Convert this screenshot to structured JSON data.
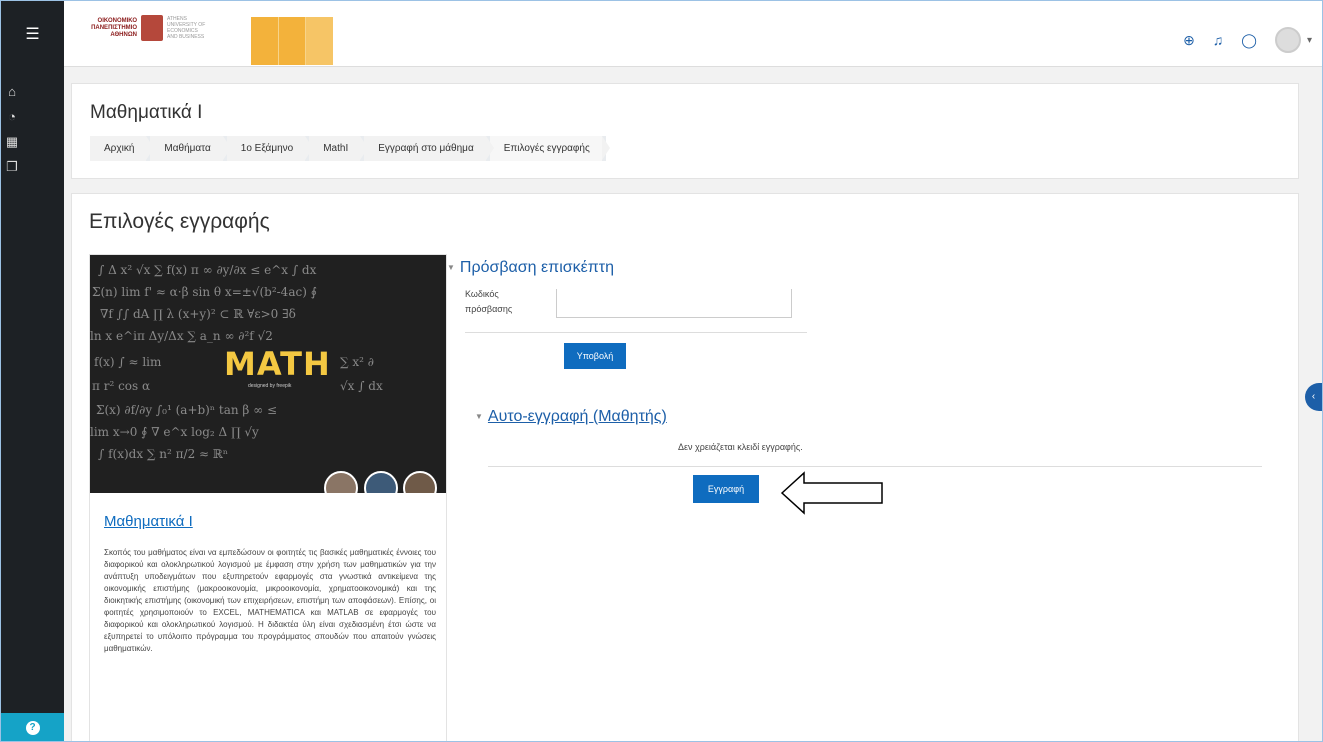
{
  "header": {
    "logo_greek": "ΟΙΚΟΝΟΜΙΚΟ ΠΑΝΕΠΙΣΤΗΜΙΟ ΑΘΗΝΩΝ",
    "logo_english": "ATHENS UNIVERSITY OF ECONOMICS AND BUSINESS"
  },
  "page": {
    "course_title": "Μαθηματικά Ι",
    "breadcrumb": [
      "Αρχική",
      "Μαθήματα",
      "1ο Εξάμηνο",
      "MathI",
      "Εγγραφή στο μάθημα",
      "Επιλογές εγγραφής"
    ],
    "heading": "Επιλογές εγγραφής"
  },
  "course": {
    "image_text": "MATH",
    "image_credit": "designed by freepik",
    "link": "Μαθηματικά Ι",
    "summary": "Σκοπός του μαθήματος είναι να εμπεδώσουν οι φοιτητές τις βασικές μαθηματικές έννοιες του διαφορικού και ολοκληρωτικού λογισμού με έμφαση στην χρήση των μαθηματικών για την ανάπτυξη υποδειγμάτων που εξυπηρετούν εφαρμογές στα γνωστικά αντικείμενα της οικονομικής επιστήμης (μακροοικονομία, μικροοικονομία, χρηματοοικονομικά) και της διοικητικής επιστήμης (οικονομική των επιχειρήσεων, επιστήμη των αποφάσεων). Επίσης, οι φοιτητές χρησιμοποιούν το EXCEL, MATHEMATICA και MATLAB σε εφαρμογές του διαφορικού και ολοκληρωτικού λογισμού. Η διδακτέα ύλη είναι σχεδιασμένη έτσι ώστε να εξυπηρετεί το υπόλοιπο πρόγραμμα του προγράμματος σπουδών που απαιτούν γνώσεις μαθηματικών."
  },
  "guest": {
    "title": "Πρόσβαση επισκέπτη",
    "password_label": "Κωδικός πρόσβασης",
    "submit": "Υποβολή"
  },
  "self_enrol": {
    "title": "Αυτο-εγγραφή (Μαθητής)",
    "no_key": "Δεν χρειάζεται κλειδί εγγραφής.",
    "button": "Εγγραφή"
  },
  "colors": {
    "accent": "#0f6cbf",
    "sidebar": "#1d2125",
    "highlight": "#15a3c7"
  }
}
